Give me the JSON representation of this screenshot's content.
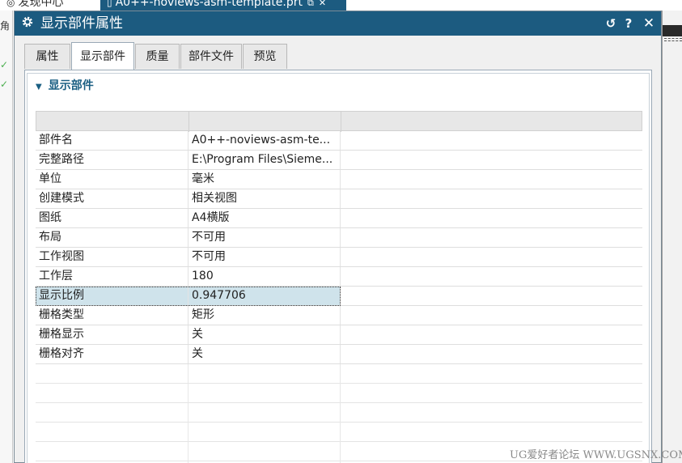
{
  "app": {
    "tab1_label": "发现中心",
    "tab2_label": "A0++-noviews-asm-template.prt",
    "tab2_close": "✕",
    "left_fragment": "角"
  },
  "dialog": {
    "title": "显示部件属性",
    "reset_glyph": "↺",
    "help_glyph": "?",
    "close_glyph": "✕",
    "tabs": [
      {
        "label": "属性"
      },
      {
        "label": "显示部件"
      },
      {
        "label": "质量"
      },
      {
        "label": "部件文件"
      },
      {
        "label": "预览"
      }
    ],
    "active_tab": "显示部件",
    "section_title": "显示部件",
    "rows": [
      {
        "name": "部件名",
        "value": "A0++-noviews-asm-te..."
      },
      {
        "name": "完整路径",
        "value": "E:\\Program Files\\Sieme..."
      },
      {
        "name": "单位",
        "value": "毫米"
      },
      {
        "name": "创建模式",
        "value": "相关视图"
      },
      {
        "name": "图纸",
        "value": "A4横版"
      },
      {
        "name": "布局",
        "value": "不可用"
      },
      {
        "name": "工作视图",
        "value": "不可用"
      },
      {
        "name": "工作层",
        "value": "180"
      },
      {
        "name": "显示比例",
        "value": "0.947706"
      },
      {
        "name": "栅格类型",
        "value": "矩形"
      },
      {
        "name": "栅格显示",
        "value": "关"
      },
      {
        "name": "栅格对齐",
        "value": "关"
      }
    ],
    "selected_row": "显示比例"
  },
  "watermark": "UG爱好者论坛 WWW.UGSNX.COM",
  "colors": {
    "titlebar": "#1c5b80",
    "section_title": "#1a5e82",
    "selected_row": "#cfe3eb"
  }
}
